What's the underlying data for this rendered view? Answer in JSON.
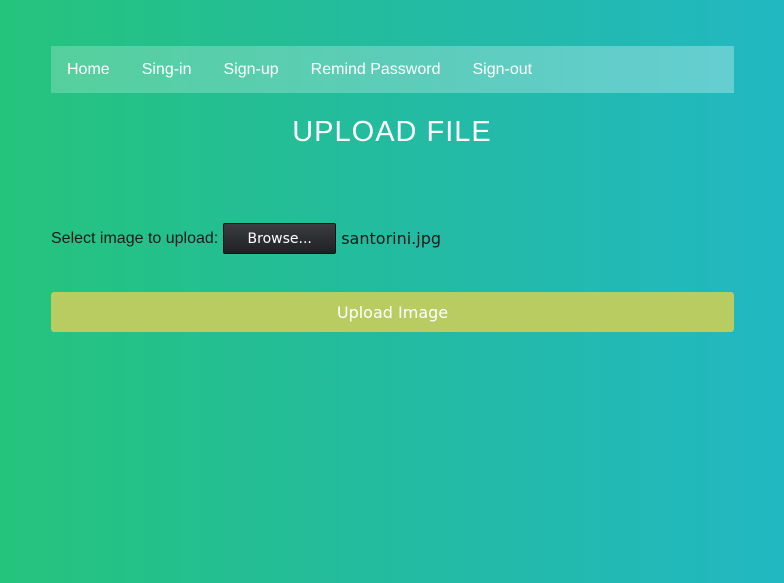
{
  "nav": {
    "items": [
      {
        "label": "Home"
      },
      {
        "label": "Sing-in"
      },
      {
        "label": "Sign-up"
      },
      {
        "label": "Remind Password"
      },
      {
        "label": "Sign-out"
      }
    ]
  },
  "main": {
    "title": "UPLOAD FILE",
    "upload": {
      "label": "Select image to upload:",
      "browse_label": "Browse...",
      "selected_file": "santorini.jpg"
    },
    "submit_label": "Upload Image"
  },
  "colors": {
    "background_start": "#25c47c",
    "background_end": "#22b8c2",
    "submit_button": "#b8cc62",
    "browse_button": "#2a2c30"
  }
}
